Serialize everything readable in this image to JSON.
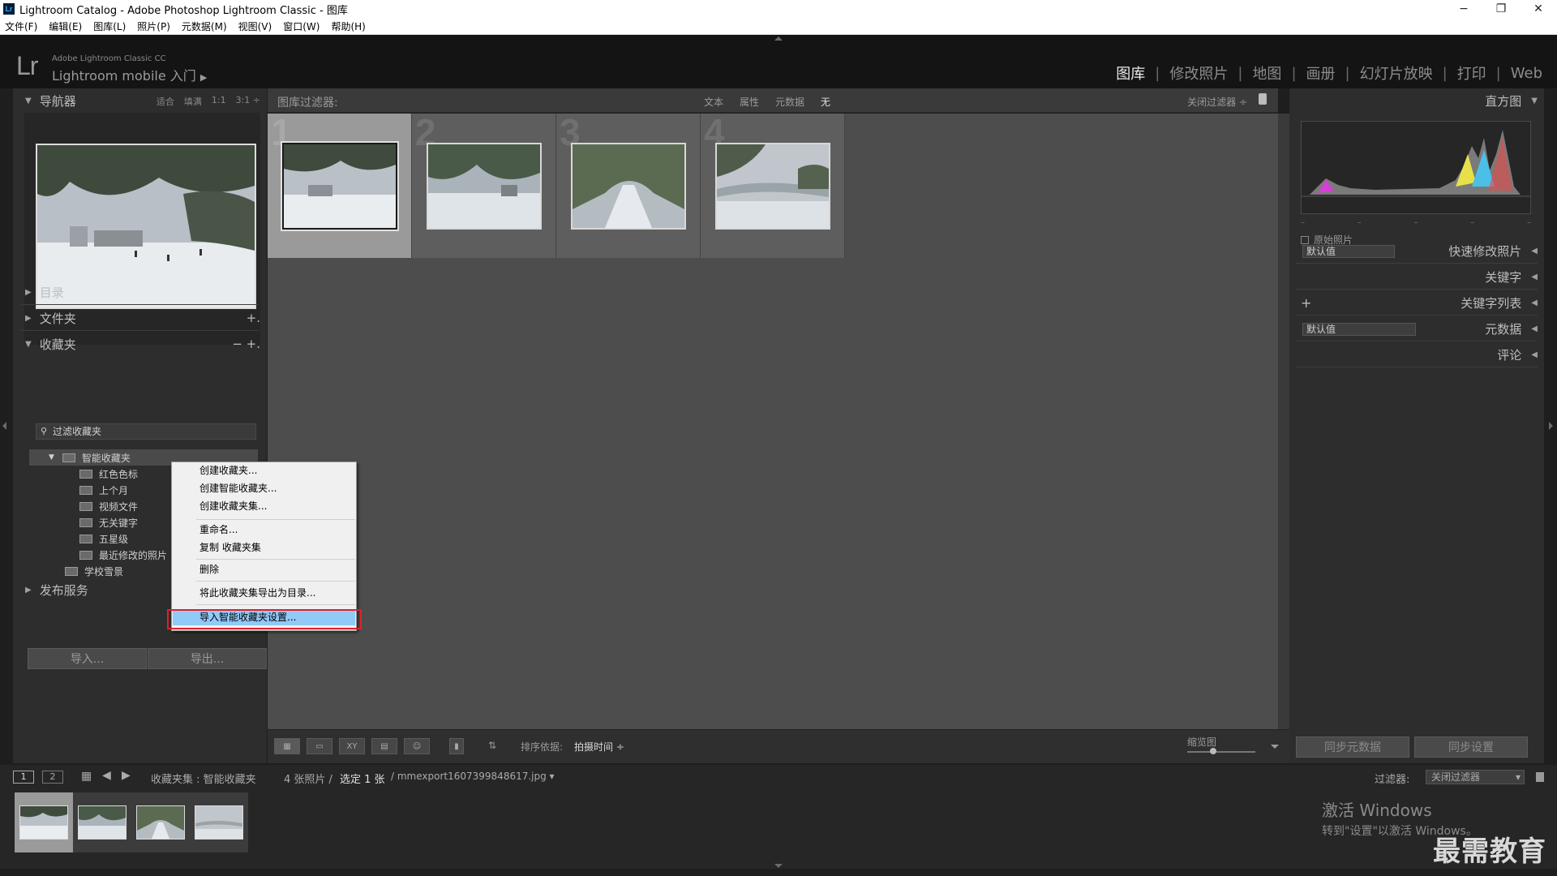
{
  "window": {
    "title": "Lightroom Catalog - Adobe Photoshop Lightroom Classic - 图库",
    "app_icon": "Lr",
    "minimize": "−",
    "restore": "❐",
    "close": "✕"
  },
  "menubar": [
    "文件(F)",
    "编辑(E)",
    "图库(L)",
    "照片(P)",
    "元数据(M)",
    "视图(V)",
    "窗口(W)",
    "帮助(H)"
  ],
  "identity": {
    "logo": "Lr",
    "small": "Adobe Lightroom Classic CC",
    "large": "Lightroom mobile 入门",
    "arrow": "▶"
  },
  "modules": [
    "图库",
    "修改照片",
    "地图",
    "画册",
    "幻灯片放映",
    "打印",
    "Web"
  ],
  "module_separator": "|",
  "left_panel": {
    "navigator": {
      "title": "导航器",
      "options": [
        "适合",
        "填满",
        "1:1",
        "3:1 ÷"
      ]
    },
    "catalog": "目录",
    "folders": "文件夹",
    "collections": "收藏夹",
    "collections_minus": "−",
    "plus": "+.",
    "filter_placeholder": "过滤收藏夹",
    "tree": {
      "smart_set": "智能收藏夹",
      "items": [
        "红色色标",
        "上个月",
        "视频文件",
        "无关键字",
        "五星级",
        "最近修改的照片"
      ],
      "school": "学校雪景"
    },
    "publish": "发布服务",
    "import_btn": "导入...",
    "export_btn": "导出..."
  },
  "filter_bar": {
    "label": "图库过滤器:",
    "options": [
      "文本",
      "属性",
      "元数据",
      "无"
    ],
    "close": "关闭过滤器 ÷"
  },
  "grid": {
    "numbers": [
      "1",
      "2",
      "3",
      "4"
    ]
  },
  "toolbar": {
    "sort_label": "排序依据:",
    "sort_value": "拍摄时间 ÷",
    "zoom_label": "缩览图"
  },
  "right_panel": {
    "histogram": "直方图",
    "original_photo": "原始照片",
    "quick_develop": "快速修改照片",
    "default_value": "默认值",
    "keywording": "关键字",
    "keyword_list": "关键字列表",
    "keyword_plus": "+",
    "metadata": "元数据",
    "comments": "评论",
    "sync_metadata": "同步元数据",
    "sync_settings": "同步设置"
  },
  "filmstrip": {
    "page1": "1",
    "page2": "2",
    "path": "收藏夹集 : 智能收藏夹",
    "count": "4 张照片 /",
    "selected": "选定 1 张",
    "filename": "/ mmexport1607399848617.jpg ▾",
    "filter_label": "过滤器:",
    "filter_value": "关闭过滤器"
  },
  "context_menu": {
    "items": [
      "创建收藏夹...",
      "创建智能收藏夹...",
      "创建收藏夹集...",
      "重命名...",
      "复制 收藏夹集",
      "删除",
      "将此收藏夹集导出为目录...",
      "导入智能收藏夹设置..."
    ]
  },
  "watermark": {
    "activate_title": "激活 Windows",
    "activate_sub": "转到\"设置\"以激活 Windows。",
    "brand": "最需教育"
  },
  "colors": {
    "highlight_frame": "#e0202a",
    "menu_highlight": "#91c9f7",
    "panel_bg": "#2d2d2d",
    "grid_bg": "#4d4d4d"
  }
}
